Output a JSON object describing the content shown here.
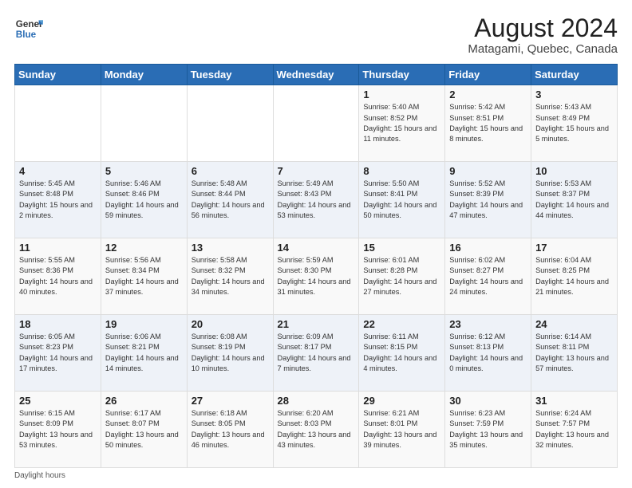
{
  "header": {
    "logo_line1": "General",
    "logo_line2": "Blue",
    "title": "August 2024",
    "subtitle": "Matagami, Quebec, Canada"
  },
  "weekdays": [
    "Sunday",
    "Monday",
    "Tuesday",
    "Wednesday",
    "Thursday",
    "Friday",
    "Saturday"
  ],
  "footer": {
    "note": "Daylight hours"
  },
  "weeks": [
    [
      {
        "day": "",
        "info": ""
      },
      {
        "day": "",
        "info": ""
      },
      {
        "day": "",
        "info": ""
      },
      {
        "day": "",
        "info": ""
      },
      {
        "day": "1",
        "info": "Sunrise: 5:40 AM\nSunset: 8:52 PM\nDaylight: 15 hours\nand 11 minutes."
      },
      {
        "day": "2",
        "info": "Sunrise: 5:42 AM\nSunset: 8:51 PM\nDaylight: 15 hours\nand 8 minutes."
      },
      {
        "day": "3",
        "info": "Sunrise: 5:43 AM\nSunset: 8:49 PM\nDaylight: 15 hours\nand 5 minutes."
      }
    ],
    [
      {
        "day": "4",
        "info": "Sunrise: 5:45 AM\nSunset: 8:48 PM\nDaylight: 15 hours\nand 2 minutes."
      },
      {
        "day": "5",
        "info": "Sunrise: 5:46 AM\nSunset: 8:46 PM\nDaylight: 14 hours\nand 59 minutes."
      },
      {
        "day": "6",
        "info": "Sunrise: 5:48 AM\nSunset: 8:44 PM\nDaylight: 14 hours\nand 56 minutes."
      },
      {
        "day": "7",
        "info": "Sunrise: 5:49 AM\nSunset: 8:43 PM\nDaylight: 14 hours\nand 53 minutes."
      },
      {
        "day": "8",
        "info": "Sunrise: 5:50 AM\nSunset: 8:41 PM\nDaylight: 14 hours\nand 50 minutes."
      },
      {
        "day": "9",
        "info": "Sunrise: 5:52 AM\nSunset: 8:39 PM\nDaylight: 14 hours\nand 47 minutes."
      },
      {
        "day": "10",
        "info": "Sunrise: 5:53 AM\nSunset: 8:37 PM\nDaylight: 14 hours\nand 44 minutes."
      }
    ],
    [
      {
        "day": "11",
        "info": "Sunrise: 5:55 AM\nSunset: 8:36 PM\nDaylight: 14 hours\nand 40 minutes."
      },
      {
        "day": "12",
        "info": "Sunrise: 5:56 AM\nSunset: 8:34 PM\nDaylight: 14 hours\nand 37 minutes."
      },
      {
        "day": "13",
        "info": "Sunrise: 5:58 AM\nSunset: 8:32 PM\nDaylight: 14 hours\nand 34 minutes."
      },
      {
        "day": "14",
        "info": "Sunrise: 5:59 AM\nSunset: 8:30 PM\nDaylight: 14 hours\nand 31 minutes."
      },
      {
        "day": "15",
        "info": "Sunrise: 6:01 AM\nSunset: 8:28 PM\nDaylight: 14 hours\nand 27 minutes."
      },
      {
        "day": "16",
        "info": "Sunrise: 6:02 AM\nSunset: 8:27 PM\nDaylight: 14 hours\nand 24 minutes."
      },
      {
        "day": "17",
        "info": "Sunrise: 6:04 AM\nSunset: 8:25 PM\nDaylight: 14 hours\nand 21 minutes."
      }
    ],
    [
      {
        "day": "18",
        "info": "Sunrise: 6:05 AM\nSunset: 8:23 PM\nDaylight: 14 hours\nand 17 minutes."
      },
      {
        "day": "19",
        "info": "Sunrise: 6:06 AM\nSunset: 8:21 PM\nDaylight: 14 hours\nand 14 minutes."
      },
      {
        "day": "20",
        "info": "Sunrise: 6:08 AM\nSunset: 8:19 PM\nDaylight: 14 hours\nand 10 minutes."
      },
      {
        "day": "21",
        "info": "Sunrise: 6:09 AM\nSunset: 8:17 PM\nDaylight: 14 hours\nand 7 minutes."
      },
      {
        "day": "22",
        "info": "Sunrise: 6:11 AM\nSunset: 8:15 PM\nDaylight: 14 hours\nand 4 minutes."
      },
      {
        "day": "23",
        "info": "Sunrise: 6:12 AM\nSunset: 8:13 PM\nDaylight: 14 hours\nand 0 minutes."
      },
      {
        "day": "24",
        "info": "Sunrise: 6:14 AM\nSunset: 8:11 PM\nDaylight: 13 hours\nand 57 minutes."
      }
    ],
    [
      {
        "day": "25",
        "info": "Sunrise: 6:15 AM\nSunset: 8:09 PM\nDaylight: 13 hours\nand 53 minutes."
      },
      {
        "day": "26",
        "info": "Sunrise: 6:17 AM\nSunset: 8:07 PM\nDaylight: 13 hours\nand 50 minutes."
      },
      {
        "day": "27",
        "info": "Sunrise: 6:18 AM\nSunset: 8:05 PM\nDaylight: 13 hours\nand 46 minutes."
      },
      {
        "day": "28",
        "info": "Sunrise: 6:20 AM\nSunset: 8:03 PM\nDaylight: 13 hours\nand 43 minutes."
      },
      {
        "day": "29",
        "info": "Sunrise: 6:21 AM\nSunset: 8:01 PM\nDaylight: 13 hours\nand 39 minutes."
      },
      {
        "day": "30",
        "info": "Sunrise: 6:23 AM\nSunset: 7:59 PM\nDaylight: 13 hours\nand 35 minutes."
      },
      {
        "day": "31",
        "info": "Sunrise: 6:24 AM\nSunset: 7:57 PM\nDaylight: 13 hours\nand 32 minutes."
      }
    ]
  ]
}
